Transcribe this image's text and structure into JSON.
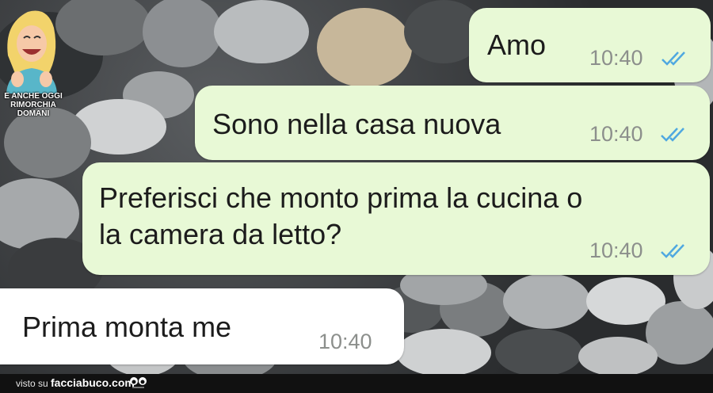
{
  "messages": [
    {
      "text": "Amo",
      "time": "10:40",
      "direction": "outgoing",
      "read": true
    },
    {
      "text": "Sono nella casa nuova",
      "time": "10:40",
      "direction": "outgoing",
      "read": true
    },
    {
      "lines": [
        "Preferisci che monto prima la cucina o",
        "la camera da letto?"
      ],
      "time": "10:40",
      "direction": "outgoing",
      "read": true
    },
    {
      "text": "Prima monta me",
      "time": "10:40",
      "direction": "incoming"
    }
  ],
  "logo": {
    "caption_line1": "E ANCHE OGGI",
    "caption_line2": "RIMORCHIA DOMANI"
  },
  "footer": {
    "visto_label": "visto su",
    "brand": "facciabuco.com"
  },
  "colors": {
    "outgoing_bubble": "#e8f9d6",
    "incoming_bubble": "#ffffff",
    "read_ticks": "#4fa8e0",
    "time_text": "#8c8f8c"
  }
}
